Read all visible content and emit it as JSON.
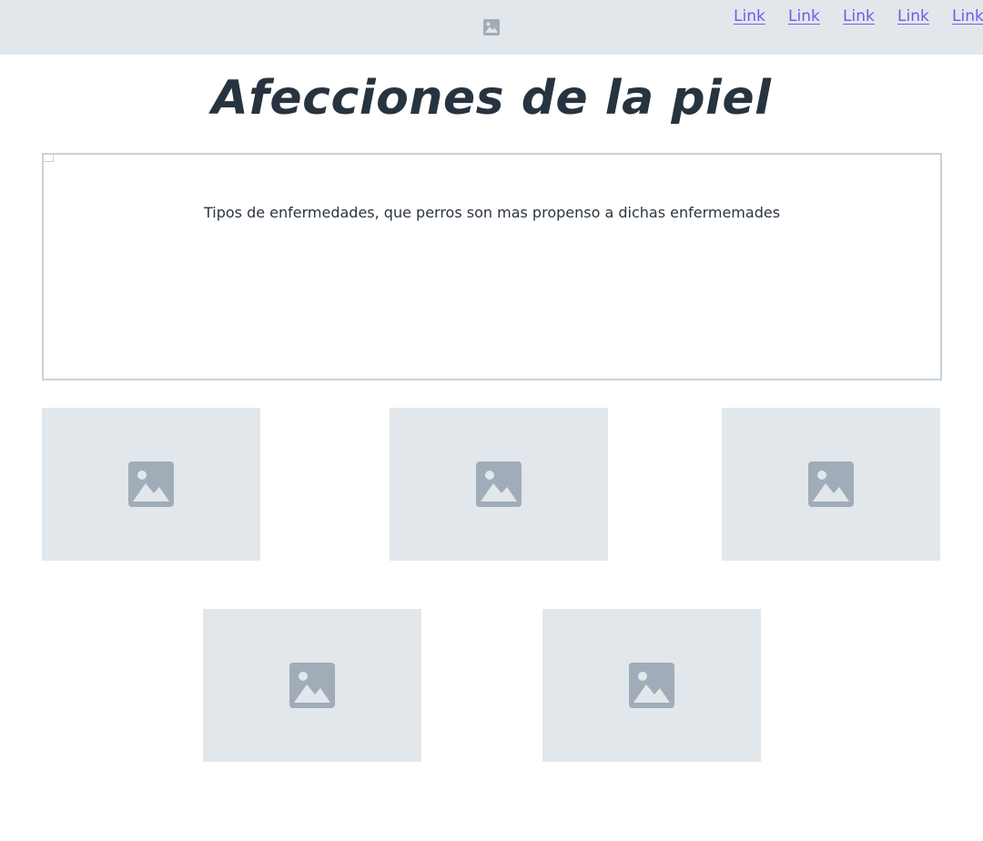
{
  "header": {
    "logo_icon": "image-icon",
    "nav_links": [
      "Link",
      "Link",
      "Link",
      "Link",
      "Link"
    ],
    "link_color": "#6b5ce7",
    "background": "#e2e7eb"
  },
  "main": {
    "title": "Afecciones de la piel",
    "description": "Tipos de enfermedades, que perros son mas propenso a dichas enfermemades"
  },
  "gallery": {
    "placeholder_icon": "image-icon",
    "items": [
      {
        "icon": "image-icon"
      },
      {
        "icon": "image-icon"
      },
      {
        "icon": "image-icon"
      },
      {
        "icon": "image-icon"
      },
      {
        "icon": "image-icon"
      }
    ]
  }
}
